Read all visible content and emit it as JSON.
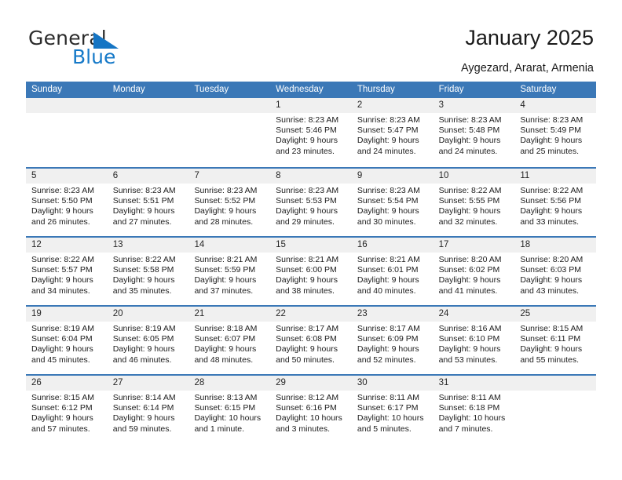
{
  "brand": {
    "name_part1": "General",
    "name_part2": "Blue",
    "triangle_color": "#1575c4",
    "blue_text_color": "#1579c8"
  },
  "header": {
    "title": "January 2025",
    "subtitle": "Aygezard, Ararat, Armenia",
    "accent_color": "#3b78b7",
    "band_color": "#f0f0f0"
  },
  "weekdays": [
    "Sunday",
    "Monday",
    "Tuesday",
    "Wednesday",
    "Thursday",
    "Friday",
    "Saturday"
  ],
  "weeks": [
    [
      {
        "day": "",
        "lines": []
      },
      {
        "day": "",
        "lines": []
      },
      {
        "day": "",
        "lines": []
      },
      {
        "day": "1",
        "lines": [
          "Sunrise: 8:23 AM",
          "Sunset: 5:46 PM",
          "Daylight: 9 hours",
          "and 23 minutes."
        ]
      },
      {
        "day": "2",
        "lines": [
          "Sunrise: 8:23 AM",
          "Sunset: 5:47 PM",
          "Daylight: 9 hours",
          "and 24 minutes."
        ]
      },
      {
        "day": "3",
        "lines": [
          "Sunrise: 8:23 AM",
          "Sunset: 5:48 PM",
          "Daylight: 9 hours",
          "and 24 minutes."
        ]
      },
      {
        "day": "4",
        "lines": [
          "Sunrise: 8:23 AM",
          "Sunset: 5:49 PM",
          "Daylight: 9 hours",
          "and 25 minutes."
        ]
      }
    ],
    [
      {
        "day": "5",
        "lines": [
          "Sunrise: 8:23 AM",
          "Sunset: 5:50 PM",
          "Daylight: 9 hours",
          "and 26 minutes."
        ]
      },
      {
        "day": "6",
        "lines": [
          "Sunrise: 8:23 AM",
          "Sunset: 5:51 PM",
          "Daylight: 9 hours",
          "and 27 minutes."
        ]
      },
      {
        "day": "7",
        "lines": [
          "Sunrise: 8:23 AM",
          "Sunset: 5:52 PM",
          "Daylight: 9 hours",
          "and 28 minutes."
        ]
      },
      {
        "day": "8",
        "lines": [
          "Sunrise: 8:23 AM",
          "Sunset: 5:53 PM",
          "Daylight: 9 hours",
          "and 29 minutes."
        ]
      },
      {
        "day": "9",
        "lines": [
          "Sunrise: 8:23 AM",
          "Sunset: 5:54 PM",
          "Daylight: 9 hours",
          "and 30 minutes."
        ]
      },
      {
        "day": "10",
        "lines": [
          "Sunrise: 8:22 AM",
          "Sunset: 5:55 PM",
          "Daylight: 9 hours",
          "and 32 minutes."
        ]
      },
      {
        "day": "11",
        "lines": [
          "Sunrise: 8:22 AM",
          "Sunset: 5:56 PM",
          "Daylight: 9 hours",
          "and 33 minutes."
        ]
      }
    ],
    [
      {
        "day": "12",
        "lines": [
          "Sunrise: 8:22 AM",
          "Sunset: 5:57 PM",
          "Daylight: 9 hours",
          "and 34 minutes."
        ]
      },
      {
        "day": "13",
        "lines": [
          "Sunrise: 8:22 AM",
          "Sunset: 5:58 PM",
          "Daylight: 9 hours",
          "and 35 minutes."
        ]
      },
      {
        "day": "14",
        "lines": [
          "Sunrise: 8:21 AM",
          "Sunset: 5:59 PM",
          "Daylight: 9 hours",
          "and 37 minutes."
        ]
      },
      {
        "day": "15",
        "lines": [
          "Sunrise: 8:21 AM",
          "Sunset: 6:00 PM",
          "Daylight: 9 hours",
          "and 38 minutes."
        ]
      },
      {
        "day": "16",
        "lines": [
          "Sunrise: 8:21 AM",
          "Sunset: 6:01 PM",
          "Daylight: 9 hours",
          "and 40 minutes."
        ]
      },
      {
        "day": "17",
        "lines": [
          "Sunrise: 8:20 AM",
          "Sunset: 6:02 PM",
          "Daylight: 9 hours",
          "and 41 minutes."
        ]
      },
      {
        "day": "18",
        "lines": [
          "Sunrise: 8:20 AM",
          "Sunset: 6:03 PM",
          "Daylight: 9 hours",
          "and 43 minutes."
        ]
      }
    ],
    [
      {
        "day": "19",
        "lines": [
          "Sunrise: 8:19 AM",
          "Sunset: 6:04 PM",
          "Daylight: 9 hours",
          "and 45 minutes."
        ]
      },
      {
        "day": "20",
        "lines": [
          "Sunrise: 8:19 AM",
          "Sunset: 6:05 PM",
          "Daylight: 9 hours",
          "and 46 minutes."
        ]
      },
      {
        "day": "21",
        "lines": [
          "Sunrise: 8:18 AM",
          "Sunset: 6:07 PM",
          "Daylight: 9 hours",
          "and 48 minutes."
        ]
      },
      {
        "day": "22",
        "lines": [
          "Sunrise: 8:17 AM",
          "Sunset: 6:08 PM",
          "Daylight: 9 hours",
          "and 50 minutes."
        ]
      },
      {
        "day": "23",
        "lines": [
          "Sunrise: 8:17 AM",
          "Sunset: 6:09 PM",
          "Daylight: 9 hours",
          "and 52 minutes."
        ]
      },
      {
        "day": "24",
        "lines": [
          "Sunrise: 8:16 AM",
          "Sunset: 6:10 PM",
          "Daylight: 9 hours",
          "and 53 minutes."
        ]
      },
      {
        "day": "25",
        "lines": [
          "Sunrise: 8:15 AM",
          "Sunset: 6:11 PM",
          "Daylight: 9 hours",
          "and 55 minutes."
        ]
      }
    ],
    [
      {
        "day": "26",
        "lines": [
          "Sunrise: 8:15 AM",
          "Sunset: 6:12 PM",
          "Daylight: 9 hours",
          "and 57 minutes."
        ]
      },
      {
        "day": "27",
        "lines": [
          "Sunrise: 8:14 AM",
          "Sunset: 6:14 PM",
          "Daylight: 9 hours",
          "and 59 minutes."
        ]
      },
      {
        "day": "28",
        "lines": [
          "Sunrise: 8:13 AM",
          "Sunset: 6:15 PM",
          "Daylight: 10 hours",
          "and 1 minute."
        ]
      },
      {
        "day": "29",
        "lines": [
          "Sunrise: 8:12 AM",
          "Sunset: 6:16 PM",
          "Daylight: 10 hours",
          "and 3 minutes."
        ]
      },
      {
        "day": "30",
        "lines": [
          "Sunrise: 8:11 AM",
          "Sunset: 6:17 PM",
          "Daylight: 10 hours",
          "and 5 minutes."
        ]
      },
      {
        "day": "31",
        "lines": [
          "Sunrise: 8:11 AM",
          "Sunset: 6:18 PM",
          "Daylight: 10 hours",
          "and 7 minutes."
        ]
      },
      {
        "day": "",
        "lines": []
      }
    ]
  ]
}
